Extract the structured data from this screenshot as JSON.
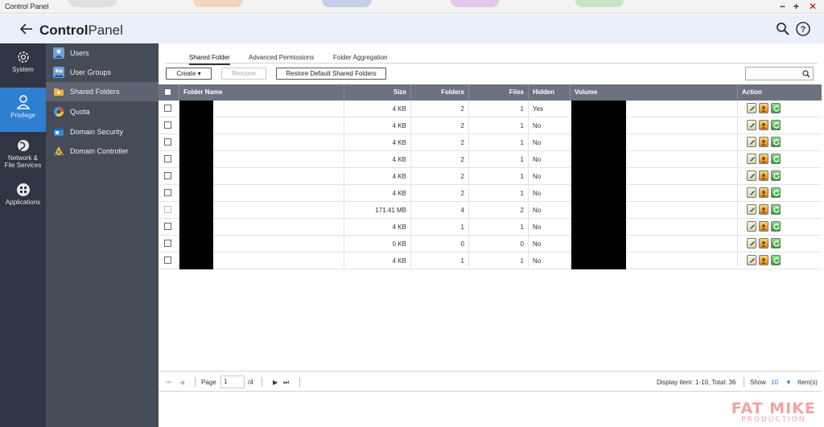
{
  "window": {
    "title": "Control Panel",
    "controls": {
      "minimize": "−",
      "maximize": "+",
      "close": "✕"
    }
  },
  "header": {
    "title_bold": "Control",
    "title_rest": "Panel"
  },
  "rail": [
    {
      "label": "System",
      "icon": "gear-icon"
    },
    {
      "label": "Privilege",
      "icon": "user-icon"
    },
    {
      "label": "Network &",
      "label2": "File Services",
      "icon": "globe-icon"
    },
    {
      "label": "Applications",
      "icon": "apps-icon"
    }
  ],
  "subnav": [
    {
      "label": "Users",
      "icon": "user-icon",
      "color": "#6aa3e0"
    },
    {
      "label": "User Groups",
      "icon": "user-group-icon",
      "color": "#6aa3e0"
    },
    {
      "label": "Shared Folders",
      "icon": "folder-icon",
      "color": "#f2b23a"
    },
    {
      "label": "Quota",
      "icon": "quota-icon",
      "color": "#e0563b"
    },
    {
      "label": "Domain Security",
      "icon": "domain-security-icon",
      "color": "#2f87d8"
    },
    {
      "label": "Domain Controller",
      "icon": "domain-controller-icon",
      "color": "#f2b23a"
    }
  ],
  "tabs": [
    "Shared Folder",
    "Advanced Permissions",
    "Folder Aggregation"
  ],
  "toolbar": {
    "create": "Create ▾",
    "remove": "Remove",
    "restore": "Restore Default Shared Folders"
  },
  "table": {
    "headers": {
      "name": "Folder Name",
      "size": "Size",
      "folders": "Folders",
      "files": "Files",
      "hidden": "Hidden",
      "volume": "Volume",
      "action": "Action"
    },
    "rows": [
      {
        "size": "4 KB",
        "folders": "2",
        "files": "1",
        "hidden": "Yes"
      },
      {
        "size": "4 KB",
        "folders": "2",
        "files": "1",
        "hidden": "No"
      },
      {
        "size": "4 KB",
        "folders": "2",
        "files": "1",
        "hidden": "No"
      },
      {
        "size": "4 KB",
        "folders": "2",
        "files": "1",
        "hidden": "No"
      },
      {
        "size": "4 KB",
        "folders": "2",
        "files": "1",
        "hidden": "No"
      },
      {
        "size": "4 KB",
        "folders": "2",
        "files": "1",
        "hidden": "No"
      },
      {
        "size": "171.41 MB",
        "folders": "4",
        "files": "2",
        "hidden": "No"
      },
      {
        "size": "4 KB",
        "folders": "1",
        "files": "1",
        "hidden": "No"
      },
      {
        "size": "0 KB",
        "folders": "0",
        "files": "0",
        "hidden": "No"
      },
      {
        "size": "4 KB",
        "folders": "1",
        "files": "1",
        "hidden": "No"
      }
    ]
  },
  "footer": {
    "page_label": "Page",
    "page_value": "1",
    "page_total": "/4",
    "display": "Display item: 1-10, Total: 36",
    "show_label": "Show",
    "show_value": "10",
    "items_label": "Item(s)"
  },
  "watermark": {
    "line1": "FAT MIKE",
    "line2": "PRODUCTION"
  },
  "colors": {
    "accent": "#2f7fd1",
    "rail": "#2f3542",
    "subnav": "#454b57",
    "table_header": "#6c737e"
  }
}
